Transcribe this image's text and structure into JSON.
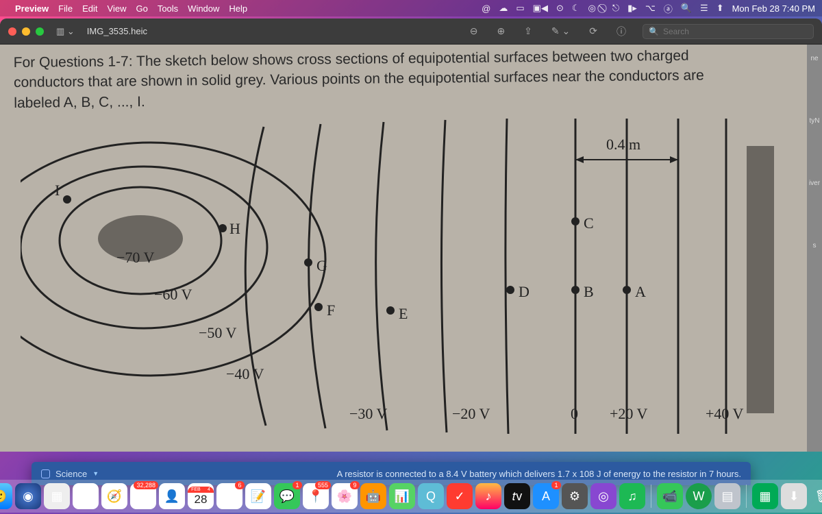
{
  "menubar": {
    "app": "Preview",
    "items": [
      "File",
      "Edit",
      "View",
      "Go",
      "Tools",
      "Window",
      "Help"
    ],
    "clock": "Mon Feb 28  7:40 PM"
  },
  "window": {
    "filename": "IMG_3535.heic",
    "search_placeholder": "Search"
  },
  "rightstrip": {
    "a": "ne",
    "b": "tyN",
    "c": "iver",
    "d": "s"
  },
  "question": {
    "line1": "For Questions 1-7: The sketch below shows cross sections of equipotential surfaces between two charged",
    "line2": "conductors that are shown in solid grey.  Various points on the equipotential surfaces near the conductors are",
    "line3": "labeled A, B, C, ..., I.",
    "scale": "0.4 m"
  },
  "chart_data": {
    "type": "diagram",
    "title": "Equipotential surfaces between two charged conductors",
    "scale_bar": {
      "length_m": 0.4
    },
    "equipotential_lines_V": [
      -70,
      -60,
      -50,
      -40,
      -30,
      -20,
      0,
      20,
      40
    ],
    "labeled_points": [
      "A",
      "B",
      "C",
      "D",
      "E",
      "F",
      "G",
      "H",
      "I"
    ],
    "conductors": [
      "left-ellipse",
      "right-slab"
    ]
  },
  "card": {
    "subject": "Science",
    "answer": "A resistor is connected to a 8.4 V battery which delivers 1.7 x 108 J of energy to the resistor in 7 hours."
  },
  "dock": {
    "mail_badge": "32,288",
    "cal_month": "FEB",
    "cal_daynum": "4",
    "cal_date": "28",
    "reminders_badge": "6",
    "messages_badge": "1",
    "maps_badge": "555",
    "photos_badge": "9",
    "appstore_badge": "1"
  }
}
